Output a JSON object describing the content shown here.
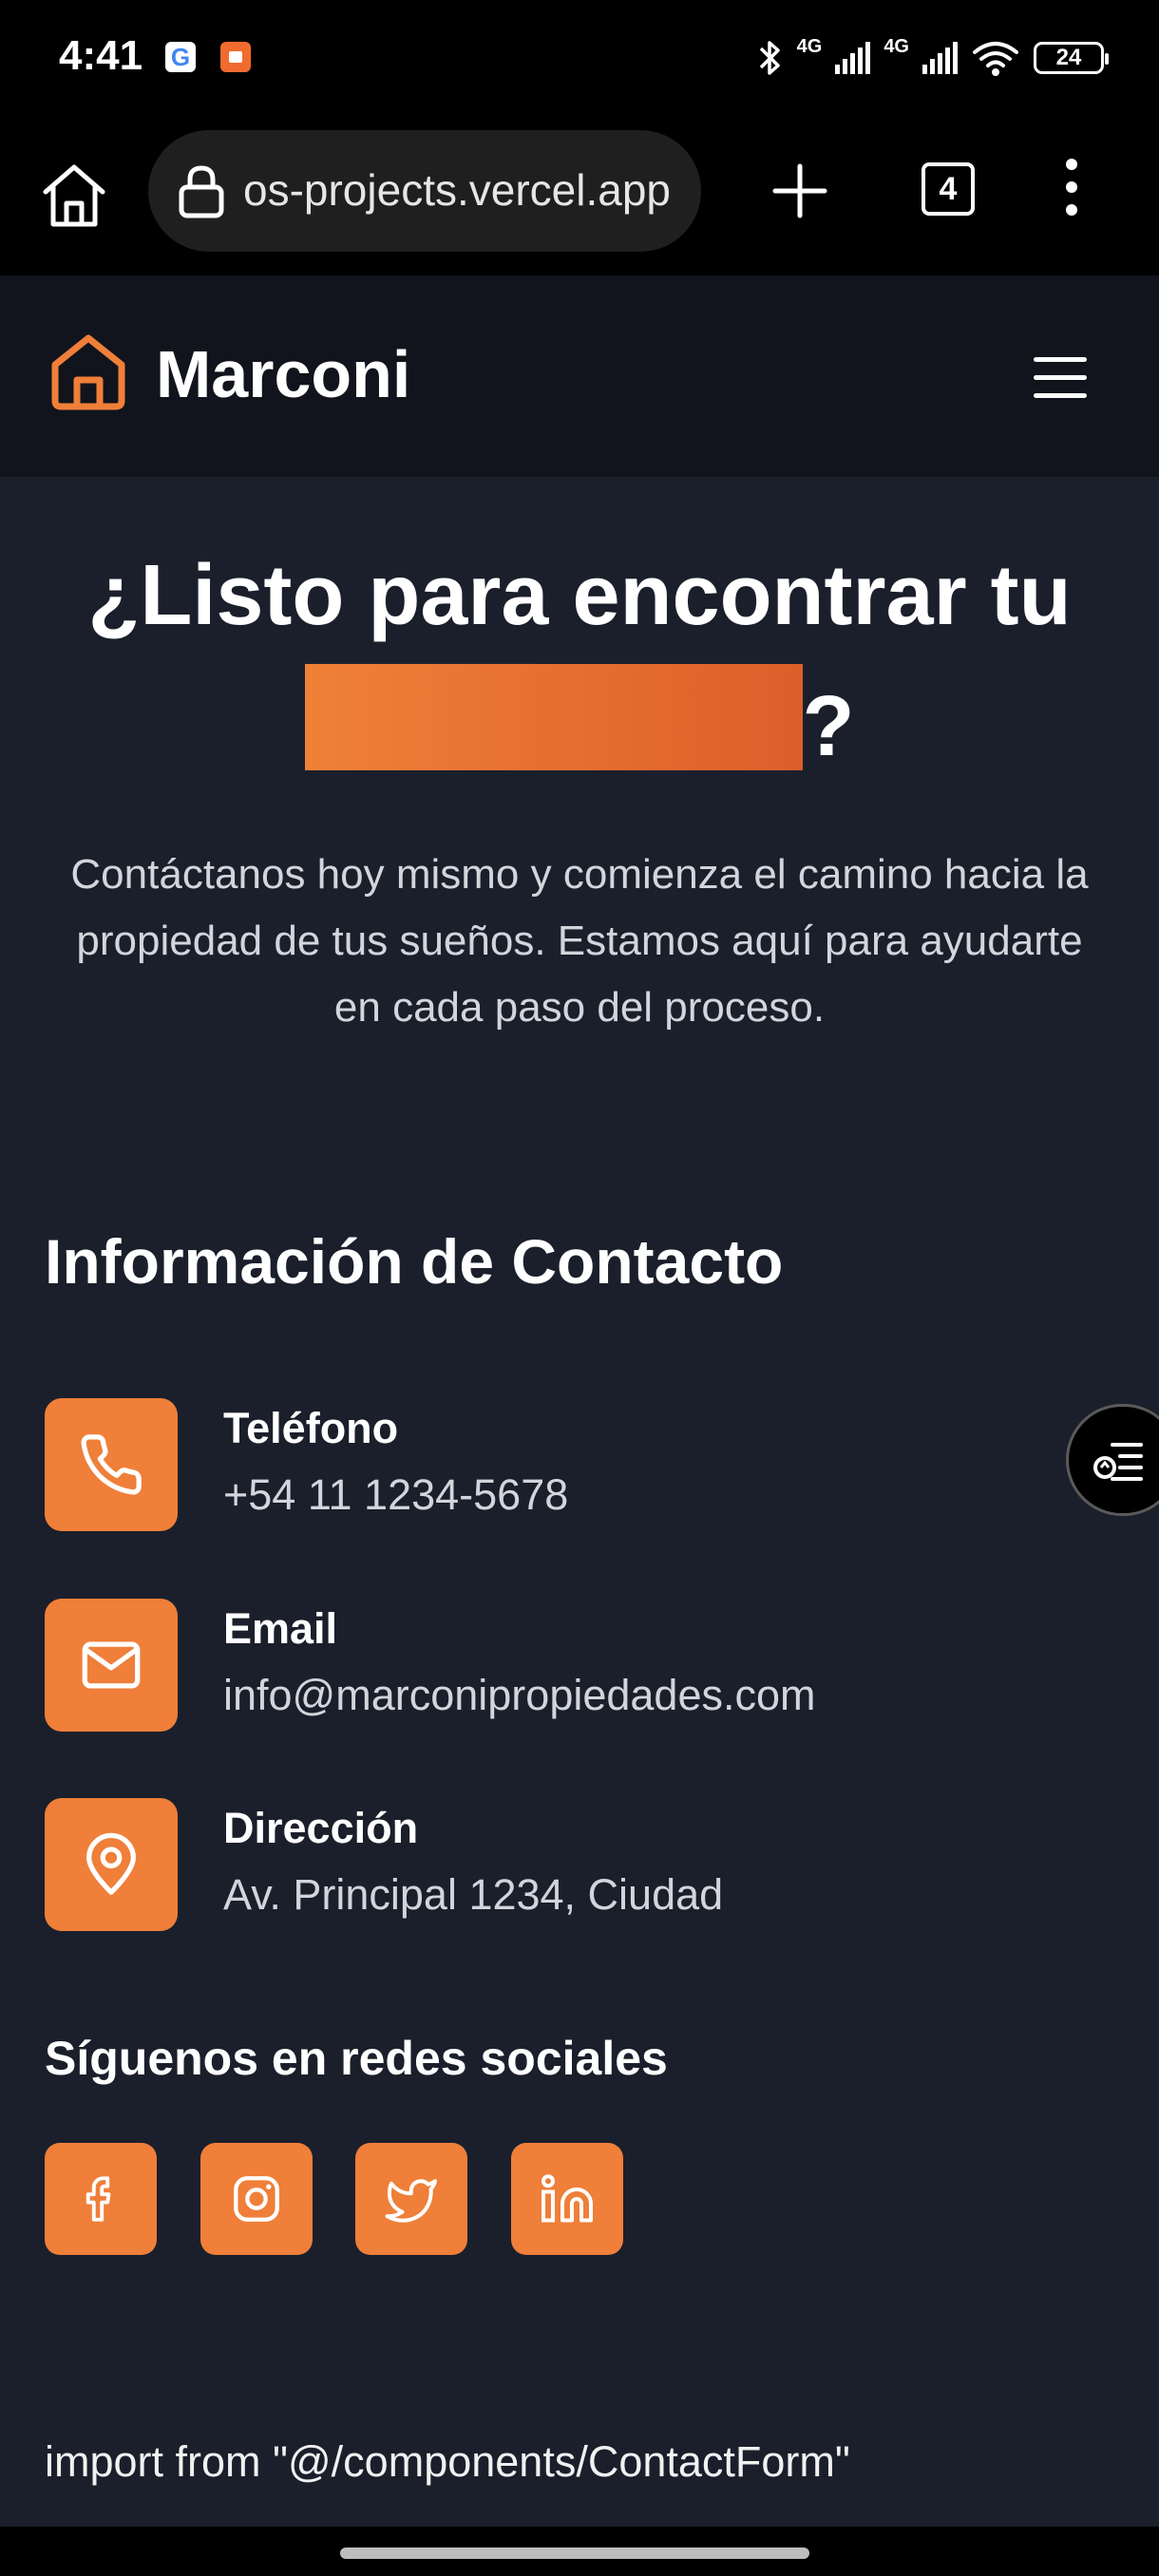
{
  "status_bar": {
    "time": "4:41",
    "google_app_letter": "G",
    "network_1": "4G",
    "network_2": "4G",
    "battery": "24"
  },
  "browser": {
    "url": "os-projects.vercel.app",
    "tab_count": "4"
  },
  "header": {
    "brand": "Marconi",
    "accent_color": "#ef7f39"
  },
  "hero": {
    "title": "¿Listo para encontrar tu",
    "title_suffix": "?",
    "description": "Contáctanos hoy mismo y comienza el camino hacia la propiedad de tus sueños. Estamos aquí para ayudarte en cada paso del proceso."
  },
  "contact": {
    "heading": "Información de Contacto",
    "items": [
      {
        "icon": "phone-icon",
        "label": "Teléfono",
        "value": "+54 11 1234-5678"
      },
      {
        "icon": "mail-icon",
        "label": "Email",
        "value": "info@marconipropiedades.com"
      },
      {
        "icon": "map-pin-icon",
        "label": "Dirección",
        "value": "Av. Principal 1234, Ciudad"
      }
    ]
  },
  "social": {
    "heading": "Síguenos en redes sociales",
    "icons": [
      "facebook-icon",
      "instagram-icon",
      "twitter-icon",
      "linkedin-icon"
    ]
  },
  "footer_code": "import from \"@/components/ContactForm\""
}
